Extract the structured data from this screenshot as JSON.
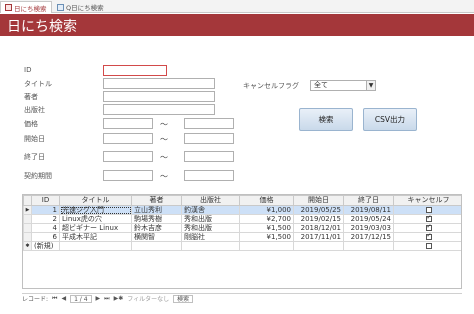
{
  "tabs": [
    {
      "label": "日にち検索",
      "active": true
    },
    {
      "label": "Q日にち検索",
      "active": false
    }
  ],
  "form": {
    "title": "日にち検索"
  },
  "fields": {
    "id": "ID",
    "title": "タイトル",
    "author": "著者",
    "publisher": "出版社",
    "price": "価格",
    "start_date": "開始日",
    "end_date": "終了日",
    "contract_period": "契約期間",
    "range_sep": "〜"
  },
  "cancel_flag": {
    "label": "キャンセルフラグ",
    "value": "全て"
  },
  "buttons": {
    "search": "検索",
    "csv": "CSV出力"
  },
  "grid": {
    "columns": [
      "ID",
      "タイトル",
      "著者",
      "出版社",
      "価格",
      "開始日",
      "終了日",
      "キャンセルフ"
    ],
    "rows": [
      {
        "id": "1",
        "title": "光速ジグ入門",
        "author": "立山秀利",
        "publisher": "釣漢舎",
        "price": "¥1,000",
        "start": "2019/05/25",
        "end": "2019/08/11",
        "cancel": false,
        "selected": true
      },
      {
        "id": "2",
        "title": "Linux虎の穴",
        "author": "駒場秀樹",
        "publisher": "秀和出版",
        "price": "¥2,700",
        "start": "2019/02/15",
        "end": "2019/05/24",
        "cancel": true,
        "selected": false
      },
      {
        "id": "4",
        "title": "超ビギナー Linux",
        "author": "鈴木吉彦",
        "publisher": "秀和出版",
        "price": "¥1,500",
        "start": "2018/12/01",
        "end": "2019/03/03",
        "cancel": true,
        "selected": false
      },
      {
        "id": "6",
        "title": "平成木平記",
        "author": "横関智",
        "publisher": "剛脳社",
        "price": "¥1,500",
        "start": "2017/11/01",
        "end": "2017/12/15",
        "cancel": true,
        "selected": false
      }
    ],
    "new_row": "(新規)"
  },
  "navigator": {
    "record_label": "レコード:",
    "position": "1 / 4",
    "filter": "フィルターなし",
    "search": "検索"
  },
  "colors": {
    "header": "#a4373a",
    "selected_row": "#cde0f7"
  }
}
